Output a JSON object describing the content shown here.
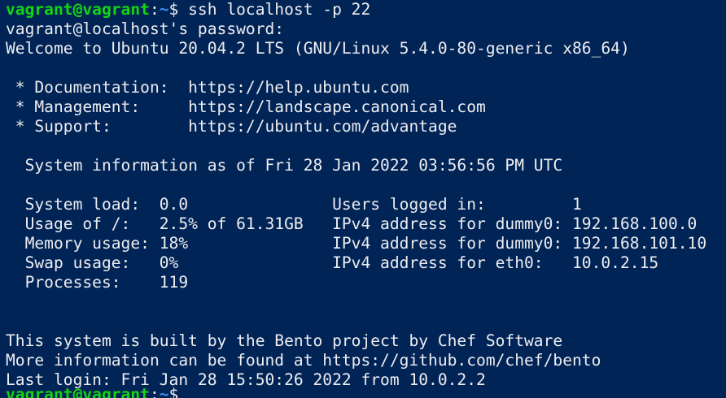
{
  "colors": {
    "background": "#012456",
    "text": "#eeedf0",
    "prompt_user_host": "#13d613",
    "prompt_path": "#3b8eea"
  },
  "prompt": {
    "user_host": "vagrant@vagrant",
    "colon": ":",
    "path": "~",
    "symbol": "$ ",
    "command": "ssh localhost -p 22"
  },
  "output": [
    "vagrant@localhost's password:",
    "Welcome to Ubuntu 20.04.2 LTS (GNU/Linux 5.4.0-80-generic x86_64)",
    "",
    " * Documentation:  https://help.ubuntu.com",
    " * Management:     https://landscape.canonical.com",
    " * Support:        https://ubuntu.com/advantage",
    "",
    "  System information as of Fri 28 Jan 2022 03:56:56 PM UTC",
    "",
    "  System load:  0.0               Users logged in:         1",
    "  Usage of /:   2.5% of 61.31GB   IPv4 address for dummy0: 192.168.100.0",
    "  Memory usage: 18%               IPv4 address for dummy0: 192.168.101.10",
    "  Swap usage:   0%                IPv4 address for eth0:   10.0.2.15",
    "  Processes:    119",
    "",
    "",
    "This system is built by the Bento project by Chef Software",
    "More information can be found at https://github.com/chef/bento",
    "Last login: Fri Jan 28 15:50:26 2022 from 10.0.2.2"
  ],
  "final_prompt": {
    "user_host": "vagrant@vagrant",
    "colon": ":",
    "path": "~",
    "symbol": "$ "
  }
}
